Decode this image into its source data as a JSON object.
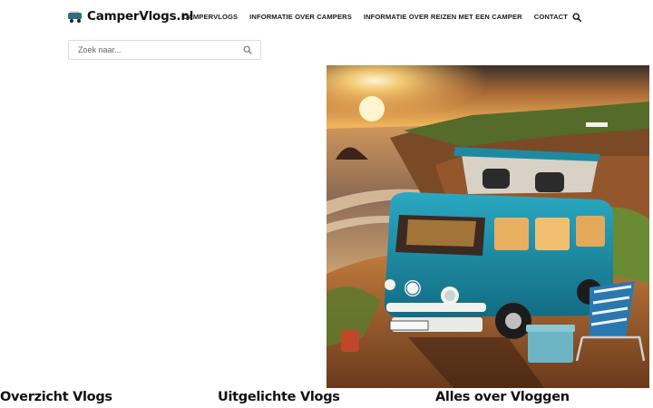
{
  "header": {
    "site_name": "CamperVlogs.nl",
    "logo_icon": "campervan-logo-icon",
    "nav": [
      {
        "label": "CAMPERVLOGS"
      },
      {
        "label": "INFORMATIE OVER CAMPERS"
      },
      {
        "label": "INFORMATIE OVER REIZEN MET EEN CAMPER"
      },
      {
        "label": "CONTACT"
      }
    ],
    "nav_search_icon": "search-icon"
  },
  "search": {
    "placeholder": "Zoek naar...",
    "value": "",
    "button_icon": "search-icon"
  },
  "hero": {
    "image": "turquoise-vw-campervan-on-cliff-at-sunset"
  },
  "sections": [
    {
      "title": "Overzicht Vlogs"
    },
    {
      "title": "Uitgelichte Vlogs"
    },
    {
      "title": "Alles over Vloggen"
    }
  ],
  "colors": {
    "text": "#111111",
    "van_turquoise": "#1f8fa6",
    "sunset_orange": "#e08a2e",
    "search_border": "#dcdcdc"
  }
}
